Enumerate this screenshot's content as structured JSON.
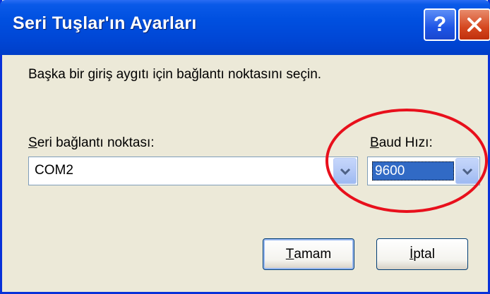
{
  "window": {
    "title": "Seri Tuşlar'ın Ayarları",
    "help_glyph": "?",
    "instruction": "Başka bir giriş aygıtı için bağlantı noktasını seçin."
  },
  "port": {
    "label_mnemonic": "S",
    "label_rest": "eri bağlantı noktası:",
    "value": "COM2"
  },
  "baud": {
    "label_mnemonic": "B",
    "label_rest": "aud Hızı:",
    "value": "9600"
  },
  "buttons": {
    "ok_mnemonic": "T",
    "ok_rest": "amam",
    "cancel_mnemonic": "İ",
    "cancel_rest": "ptal"
  },
  "colors": {
    "titlebar": "#0050e0",
    "annotation": "#e8101c"
  },
  "icons": [
    "help-icon",
    "close-icon",
    "chevron-down-icon"
  ]
}
